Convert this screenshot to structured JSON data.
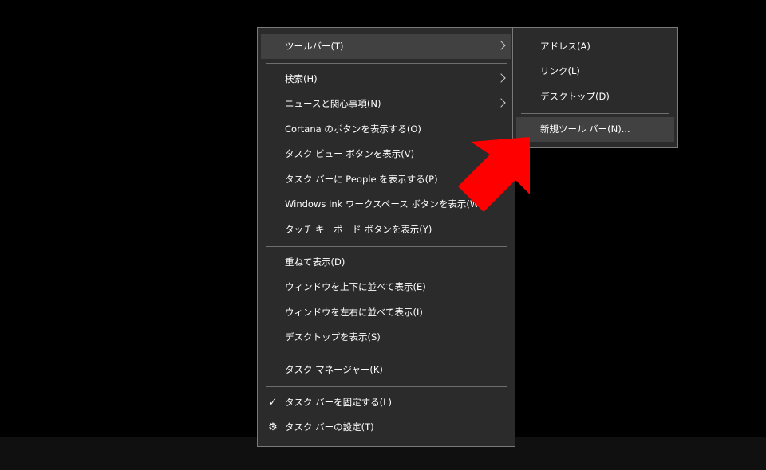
{
  "context_menu": {
    "items": [
      {
        "label": "ツールバー(T)"
      },
      {
        "label": "検索(H)"
      },
      {
        "label": "ニュースと関心事項(N)"
      },
      {
        "label": "Cortana のボタンを表示する(O)"
      },
      {
        "label": "タスク ビュー ボタンを表示(V)"
      },
      {
        "label": "タスク バーに People を表示する(P)"
      },
      {
        "label": "Windows Ink ワークスペース ボタンを表示(W)"
      },
      {
        "label": "タッチ キーボード ボタンを表示(Y)"
      },
      {
        "label": "重ねて表示(D)"
      },
      {
        "label": "ウィンドウを上下に並べて表示(E)"
      },
      {
        "label": "ウィンドウを左右に並べて表示(I)"
      },
      {
        "label": "デスクトップを表示(S)"
      },
      {
        "label": "タスク マネージャー(K)"
      },
      {
        "label": "タスク バーを固定する(L)"
      },
      {
        "label": "タスク バーの設定(T)"
      }
    ],
    "icons": {
      "check": "✓",
      "settings": "⚙"
    }
  },
  "toolbar_submenu": {
    "items": [
      {
        "label": "アドレス(A)"
      },
      {
        "label": "リンク(L)"
      },
      {
        "label": "デスクトップ(D)"
      },
      {
        "label": "新規ツール バー(N)..."
      }
    ]
  },
  "colors": {
    "menu_bg": "#2b2b2b",
    "highlight": "#414141",
    "pointer_arrow": "#ff0000"
  }
}
